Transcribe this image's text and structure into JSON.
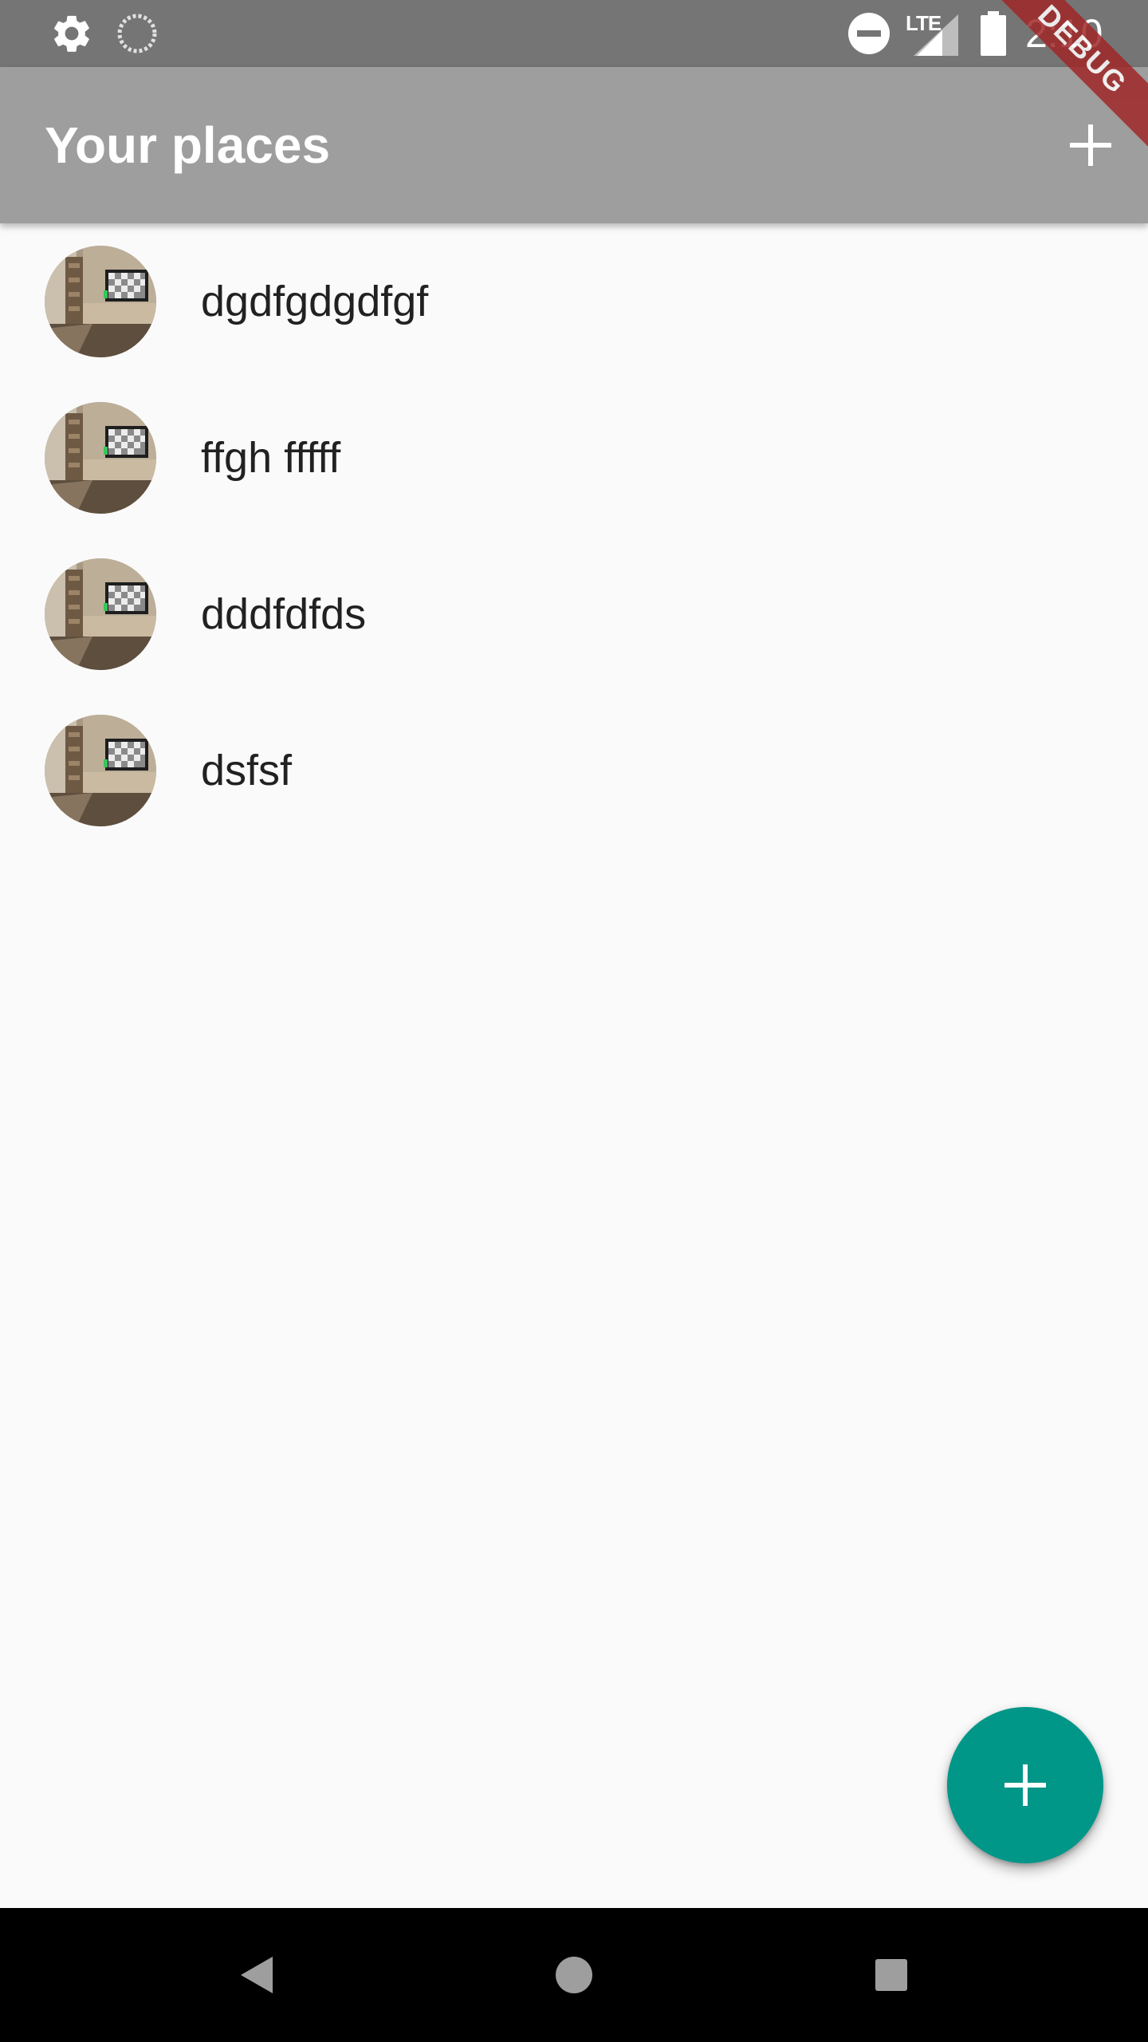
{
  "status_bar": {
    "network_type": "LTE",
    "time": "2:10",
    "icons": [
      "gear-icon",
      "spinner-icon",
      "do-not-disturb-icon",
      "signal-icon",
      "battery-icon"
    ]
  },
  "app_bar": {
    "title": "Your places",
    "action_icon": "plus-icon"
  },
  "debug_banner": {
    "label": "DEBUG"
  },
  "places": [
    {
      "title": "dgdfgdgdfgf"
    },
    {
      "title": "ffgh fffff"
    },
    {
      "title": "dddfdfds"
    },
    {
      "title": "dsfsf"
    }
  ],
  "fab": {
    "icon": "plus-icon"
  },
  "nav_bar": {
    "icons": [
      "back-icon",
      "home-icon",
      "recents-icon"
    ]
  },
  "colors": {
    "status_bar": "#757575",
    "app_bar": "#9e9e9e",
    "background": "#fafafa",
    "fab": "#009688",
    "debug_banner": "#a02828",
    "nav_bar": "#000000"
  }
}
